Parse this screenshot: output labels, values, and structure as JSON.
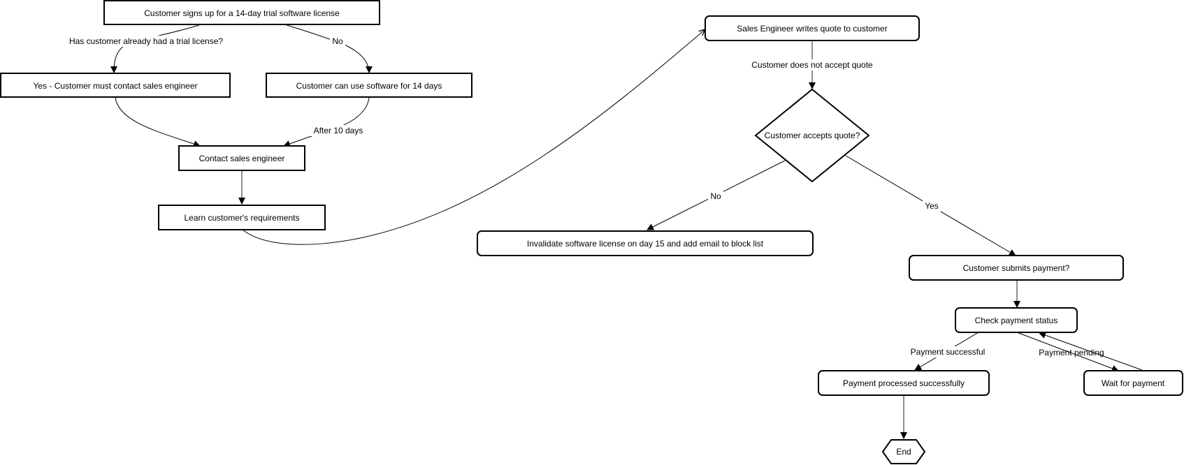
{
  "diagram": {
    "type": "flowchart",
    "nodes": {
      "signup": {
        "label": "Customer signs up for a 14-day trial software license",
        "shape": "rect"
      },
      "yes_contact": {
        "label": "Yes - Customer must contact sales engineer",
        "shape": "rect"
      },
      "use_14": {
        "label": "Customer can use software for 14 days",
        "shape": "rect"
      },
      "contact_se": {
        "label": "Contact sales engineer",
        "shape": "rect"
      },
      "learn_req": {
        "label": "Learn customer's requirements",
        "shape": "rect"
      },
      "write_quote": {
        "label": "Sales Engineer writes quote to customer",
        "shape": "rounded"
      },
      "accepts": {
        "label": "Customer accepts quote?",
        "shape": "diamond"
      },
      "invalidate": {
        "label": "Invalidate software license on day 15 and add email to block list",
        "shape": "rounded"
      },
      "submits": {
        "label": "Customer submits payment?",
        "shape": "rounded"
      },
      "check_status": {
        "label": "Check payment status",
        "shape": "rounded"
      },
      "processed": {
        "label": "Payment processed successfully",
        "shape": "rounded"
      },
      "wait": {
        "label": "Wait for payment",
        "shape": "rounded"
      },
      "end": {
        "label": "End",
        "shape": "hexagon"
      }
    },
    "edges": [
      {
        "from": "signup",
        "to": "yes_contact",
        "label": "Has customer already had a trial license?"
      },
      {
        "from": "signup",
        "to": "use_14",
        "label": "No"
      },
      {
        "from": "yes_contact",
        "to": "contact_se",
        "label": ""
      },
      {
        "from": "use_14",
        "to": "contact_se",
        "label": "After 10 days"
      },
      {
        "from": "contact_se",
        "to": "learn_req",
        "label": ""
      },
      {
        "from": "learn_req",
        "to": "write_quote",
        "label": ""
      },
      {
        "from": "write_quote",
        "to": "accepts",
        "label": "Customer does not accept quote"
      },
      {
        "from": "accepts",
        "to": "invalidate",
        "label": "No"
      },
      {
        "from": "accepts",
        "to": "submits",
        "label": "Yes"
      },
      {
        "from": "submits",
        "to": "check_status",
        "label": ""
      },
      {
        "from": "check_status",
        "to": "processed",
        "label": "Payment successful"
      },
      {
        "from": "check_status",
        "to": "wait",
        "label": "Payment pending"
      },
      {
        "from": "wait",
        "to": "check_status",
        "label": ""
      },
      {
        "from": "processed",
        "to": "end",
        "label": ""
      }
    ],
    "colors": {
      "stroke": "#000000",
      "fill": "#ffffff",
      "text": "#000000",
      "vertical_connector": "#555555"
    }
  }
}
